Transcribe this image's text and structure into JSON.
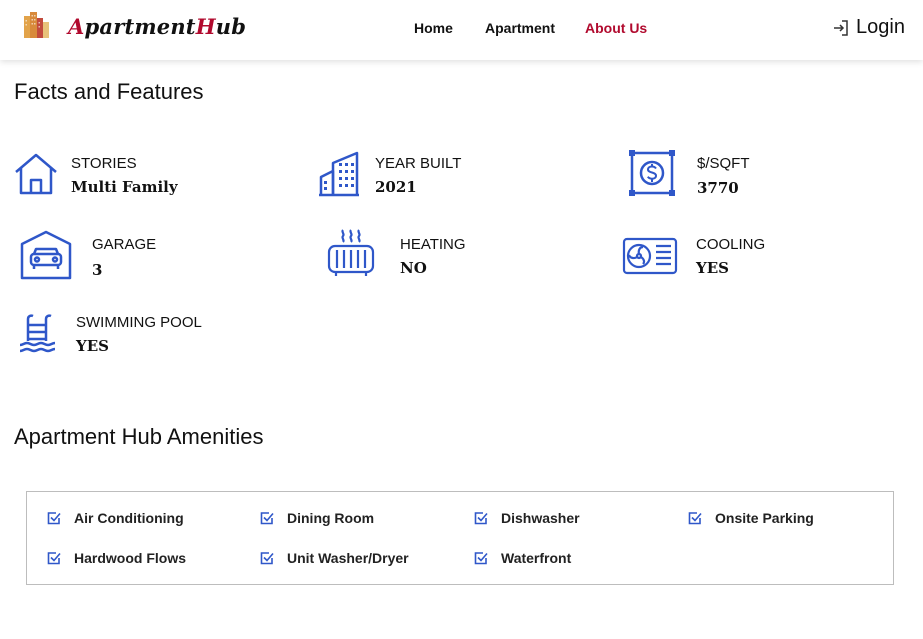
{
  "header": {
    "brand": {
      "part1": "A",
      "part2": "partment",
      "part3": "H",
      "part4": "ub"
    },
    "nav": [
      "Home",
      "Apartment",
      "About Us"
    ],
    "active_nav": "About Us",
    "login_label": "Login"
  },
  "colors": {
    "accent": "#b10a2e",
    "icon_blue": "#2f57c9"
  },
  "facts": {
    "title": "Facts and Features",
    "items": [
      {
        "label": "STORIES",
        "value": "Multi Family",
        "icon": "house-icon"
      },
      {
        "label": "YEAR BUILT",
        "value": "2021",
        "icon": "building-icon"
      },
      {
        "label": "$/SQFT",
        "value": "3770",
        "icon": "dollar-icon"
      },
      {
        "label": "GARAGE",
        "value": "3",
        "icon": "garage-icon"
      },
      {
        "label": "HEATING",
        "value": "NO",
        "icon": "heater-icon"
      },
      {
        "label": "COOLING",
        "value": "YES",
        "icon": "ac-icon"
      },
      {
        "label": "SWIMMING POOL",
        "value": "YES",
        "icon": "pool-icon"
      }
    ]
  },
  "amenities": {
    "title": "Apartment Hub Amenities",
    "items": [
      "Air Conditioning",
      "Dining Room",
      "Dishwasher",
      "Onsite Parking",
      "Hardwood Flows",
      "Unit Washer/Dryer",
      "Waterfront"
    ]
  }
}
